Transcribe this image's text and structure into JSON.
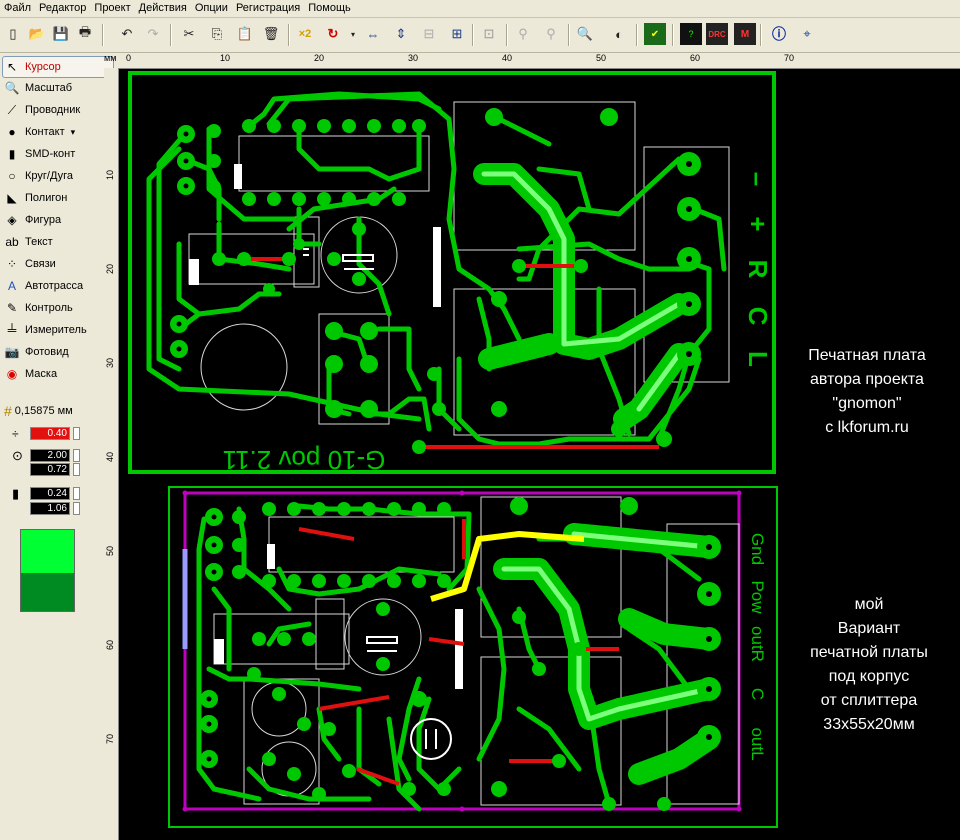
{
  "menu": [
    "Файл",
    "Редактор",
    "Проект",
    "Действия",
    "Опции",
    "Регистрация",
    "Помощь"
  ],
  "ruler": {
    "unit": "мм",
    "top_ticks": [
      "0",
      "10",
      "20",
      "30",
      "40",
      "50",
      "60",
      "70"
    ],
    "left_ticks": [
      "10",
      "20",
      "30",
      "40",
      "50",
      "60",
      "70"
    ]
  },
  "tools": [
    {
      "label": "Курсор",
      "icon": "cursor-icon",
      "selected": true
    },
    {
      "label": "Масштаб",
      "icon": "zoom-icon"
    },
    {
      "label": "Проводник",
      "icon": "track-icon"
    },
    {
      "label": "Контакт",
      "icon": "pad-icon"
    },
    {
      "label": "SMD-конт",
      "icon": "smd-icon"
    },
    {
      "label": "Круг/Дуга",
      "icon": "circle-icon"
    },
    {
      "label": "Полигон",
      "icon": "polygon-icon"
    },
    {
      "label": "Фигура",
      "icon": "shape-icon"
    },
    {
      "label": "Текст",
      "icon": "text-icon"
    },
    {
      "label": "Связи",
      "icon": "connections-icon"
    },
    {
      "label": "Автотрасса",
      "icon": "autoroute-icon"
    },
    {
      "label": "Контроль",
      "icon": "check-icon"
    },
    {
      "label": "Измеритель",
      "icon": "ruler-icon"
    },
    {
      "label": "Фотовид",
      "icon": "photo-icon"
    },
    {
      "label": "Маска",
      "icon": "mask-icon"
    }
  ],
  "grid": "0,15875 мм",
  "params": {
    "track_width": "0.40",
    "pad_outer": "2.00",
    "pad_inner": "0.72",
    "clearance_a": "0.24",
    "clearance_b": "1.06"
  },
  "colors": {
    "copper": "#00c800",
    "copper_light": "#7dff7d",
    "jumper": "#e01010",
    "board_outline": "#00c800",
    "keepout": "#c000c0",
    "highlight": "#ffff00",
    "swatch_top": "#00ff33",
    "swatch_bottom": "#008a22"
  },
  "board_top": {
    "silk_label": "G-10 pov 2.11",
    "edge_labels": [
      "–",
      "+",
      "R",
      "C",
      "L"
    ]
  },
  "board_bottom": {
    "edge_labels": [
      "Gnd",
      "Pow",
      "outR",
      "C",
      "outL"
    ]
  },
  "notes": {
    "top": [
      "Печатная плата",
      "автора проекта",
      "\"gnomon\"",
      "с lkforum.ru"
    ],
    "bottom": [
      "мой",
      "Вариант",
      "печатной платы",
      "под корпус",
      "от сплиттера",
      "33x55x20мм"
    ]
  }
}
